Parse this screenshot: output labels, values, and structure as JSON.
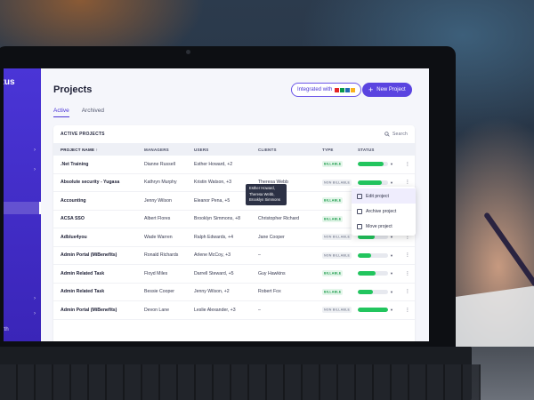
{
  "sidebar": {
    "title": "atus",
    "bottom_text": "sworth"
  },
  "header": {
    "title": "Projects",
    "integrated_label": "Integrated with",
    "integrated_brand": "ZOHO",
    "new_project_label": "New Project"
  },
  "tabs": [
    {
      "label": "Active"
    },
    {
      "label": "Archived"
    }
  ],
  "card": {
    "title": "ACTIVE PROJECTS",
    "search_label": "Search"
  },
  "columns": [
    "PROJECT NAME ↑",
    "MANAGERS",
    "USERS",
    "CLIENTS",
    "TYPE",
    "STATUS"
  ],
  "rows": [
    {
      "name": ".Net Training",
      "manager": "Dianne Russell",
      "users": "Esther Howard, +2",
      "client": "",
      "type": "BILLABLE",
      "progress": 0.85
    },
    {
      "name": "Absolute security - Yugasa",
      "manager": "Kathryn Murphy",
      "users": "Kristin Watson, +3",
      "client": "Theresa Webb",
      "type": "NON BILLABLE",
      "progress": 0.8
    },
    {
      "name": "Accounting",
      "manager": "Jenny Wilson",
      "users": "Eleanor Pena, +5",
      "client": "–",
      "type": "BILLABLE",
      "progress": 0.75
    },
    {
      "name": "ACSA SSO",
      "manager": "Albert Flores",
      "users": "Brooklyn Simmons, +8",
      "client": "Christopher Richard",
      "type": "BILLABLE",
      "progress": 0.75
    },
    {
      "name": "Adblue4you",
      "manager": "Wade Warren",
      "users": "Ralph Edwards, +4",
      "client": "Jane Cooper",
      "type": "NON BILLABLE",
      "progress": 0.55
    },
    {
      "name": "Admin Portal (MiBenefits)",
      "manager": "Ronald Richards",
      "users": "Arlene McCoy, +3",
      "client": "–",
      "type": "NON BILLABLE",
      "progress": 0.45
    },
    {
      "name": "Admin Related Task",
      "manager": "Floyd Miles",
      "users": "Darrell Steward, +5",
      "client": "Guy Hawkins",
      "type": "BILLABLE",
      "progress": 0.6
    },
    {
      "name": "Admin Related Task",
      "manager": "Bessie Cooper",
      "users": "Jenny Wilson, +2",
      "client": "Robert Fox",
      "type": "BILLABLE",
      "progress": 0.5
    },
    {
      "name": "Admin Portal (MiBenefits)",
      "manager": "Devon Lane",
      "users": "Leslie Alexander, +3",
      "client": "–",
      "type": "NON BILLABLE",
      "progress": 1.0
    }
  ],
  "tooltip": [
    "Esther Howard,",
    "Theresa Webb,",
    "Brooklyn Simmons"
  ],
  "menu": [
    {
      "label": "Edit project",
      "icon": "edit-icon"
    },
    {
      "label": "Archive project",
      "icon": "archive-icon"
    },
    {
      "label": "Move project",
      "icon": "move-icon"
    }
  ],
  "colors": {
    "accent": "#4a35d6",
    "progress": "#22c55e"
  }
}
